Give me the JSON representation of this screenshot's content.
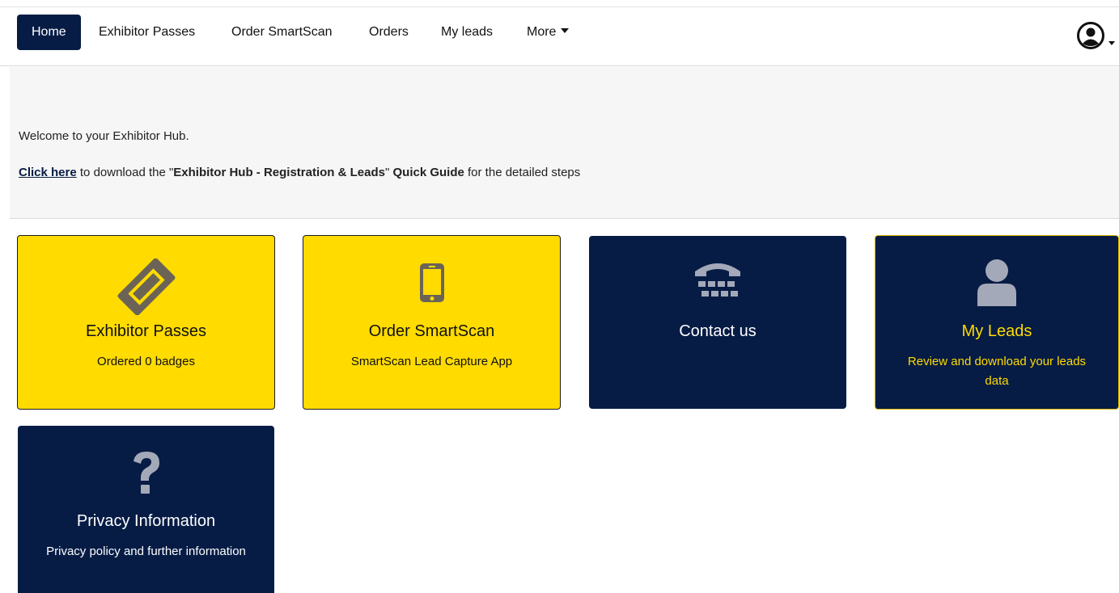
{
  "nav": {
    "items": [
      {
        "label": "Home",
        "active": true
      },
      {
        "label": "Exhibitor Passes"
      },
      {
        "label": "Order SmartScan"
      },
      {
        "label": "Orders"
      },
      {
        "label": "My leads"
      },
      {
        "label": "More"
      }
    ],
    "user_icon": "user-circle-icon"
  },
  "intro": {
    "welcome": "Welcome to your Exhibitor Hub.",
    "link_text": "Click here",
    "text_before_guide": " to download the \"",
    "guide_name": "Exhibitor Hub - Registration & Leads",
    "text_mid": "\" ",
    "guide_label": "Quick Guide",
    "text_after": " for the detailed steps"
  },
  "tiles": [
    {
      "title": "Exhibitor Passes",
      "subtitle": "Ordered 0 badges",
      "icon": "ticket-icon",
      "color": "#ffdb00"
    },
    {
      "title": "Order SmartScan",
      "subtitle": "SmartScan Lead Capture App",
      "icon": "mobile-phone-icon",
      "color": "#ffdb00"
    },
    {
      "title": "Contact us",
      "subtitle": "",
      "icon": "telephone-icon",
      "color": "#061c45"
    },
    {
      "title": "My Leads",
      "subtitle": "Review and download your leads data",
      "icon": "user-icon",
      "color": "#061c45"
    },
    {
      "title": "Privacy Information",
      "subtitle": "Privacy policy and further information",
      "icon": "question-mark-icon",
      "color": "#061c45"
    }
  ],
  "colors": {
    "navy": "#061c45",
    "yellow": "#ffdb00",
    "icon_gray_dark": "#6b6456",
    "icon_gray_light": "#a3a9b8"
  }
}
